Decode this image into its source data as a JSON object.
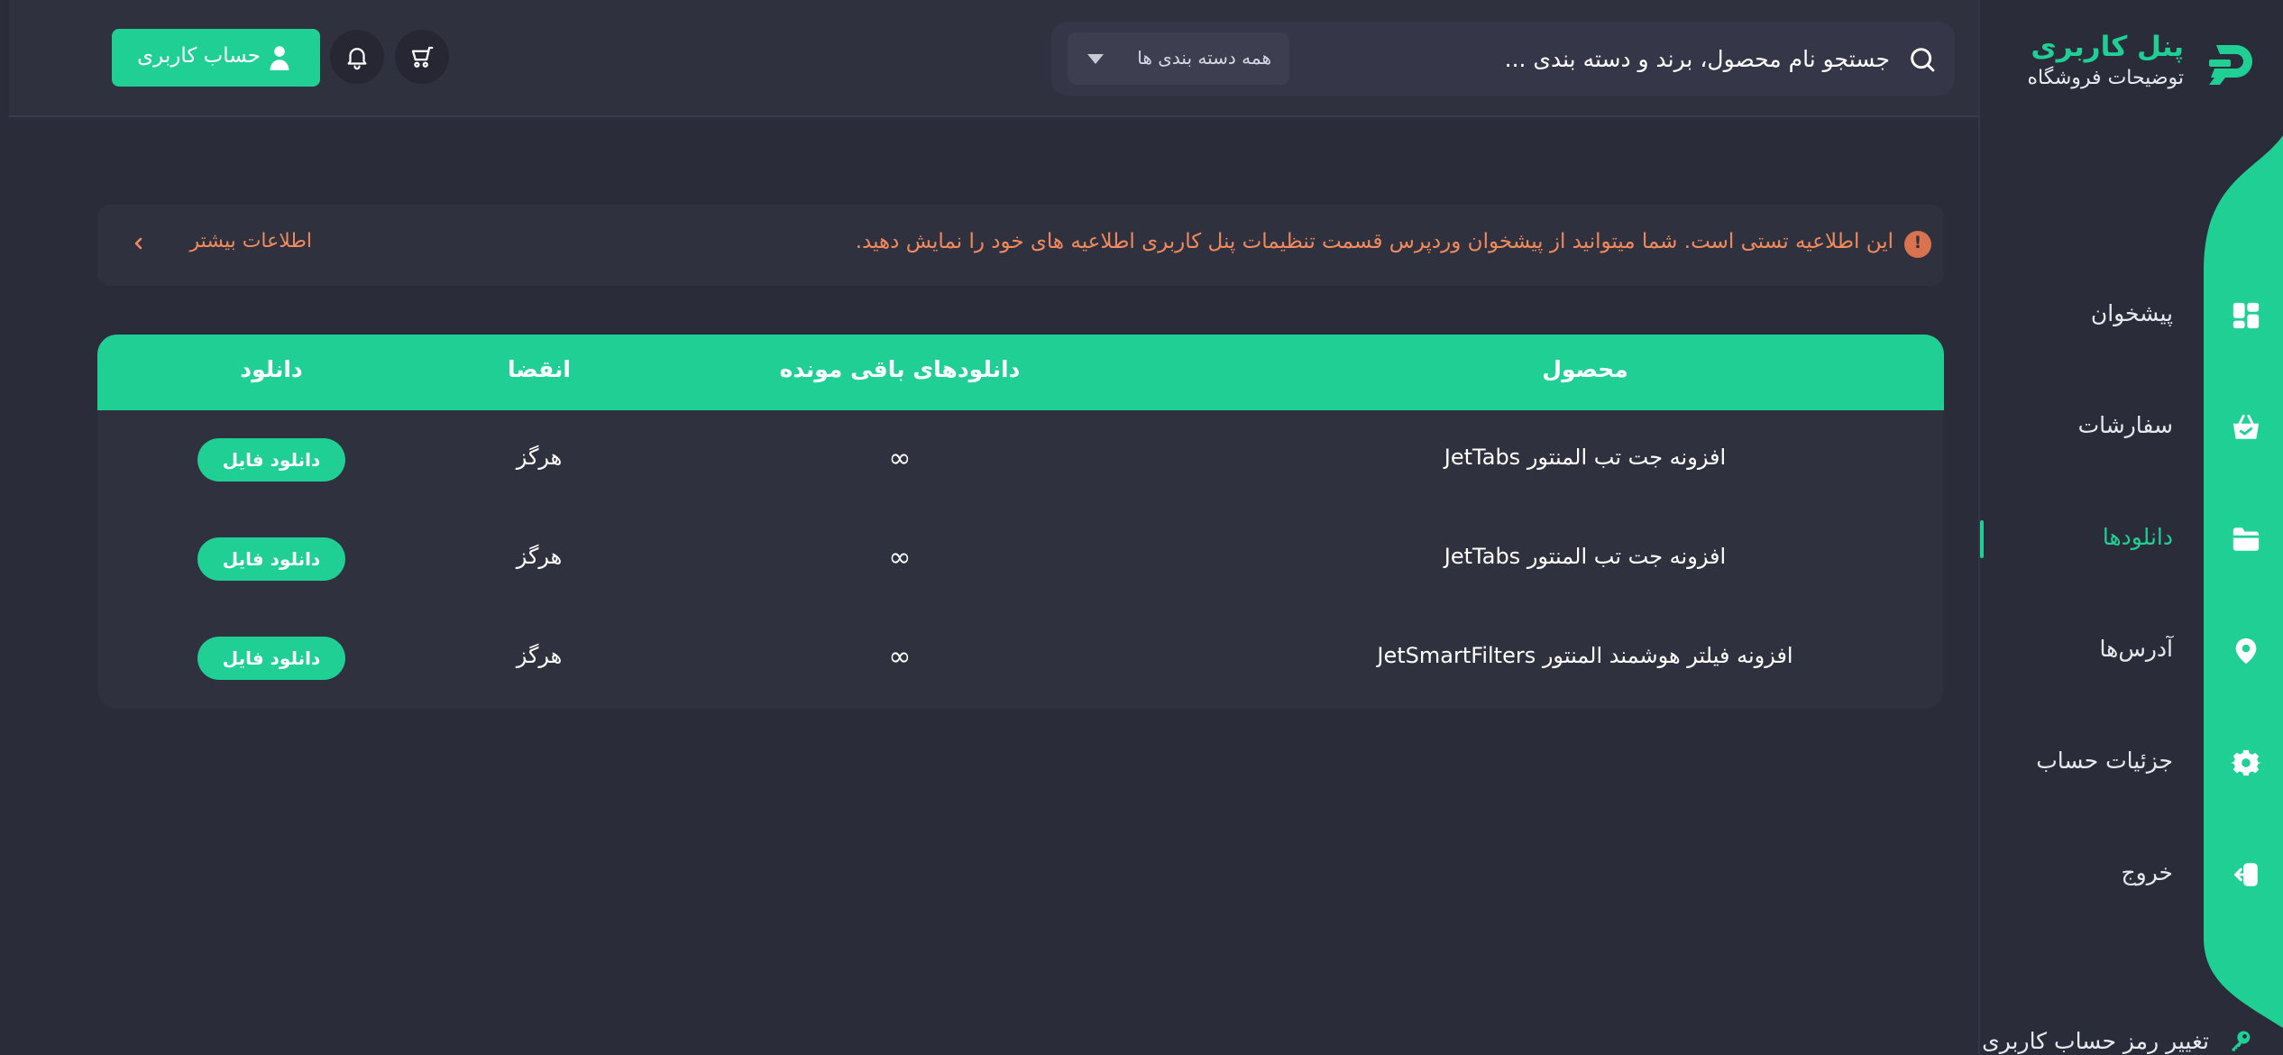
{
  "brand": {
    "title": "پنل کاربری",
    "subtitle": "توضیحات فروشگاه",
    "logo_icon": "brand-logo-icon"
  },
  "sidebar": {
    "items": [
      {
        "label": "پیشخوان",
        "icon": "dashboard-grid-icon",
        "active": false
      },
      {
        "label": "سفارشات",
        "icon": "basket-icon",
        "active": false
      },
      {
        "label": "دانلودها",
        "icon": "folder-icon",
        "active": true
      },
      {
        "label": "آدرس‌ها",
        "icon": "location-pin-icon",
        "active": false
      },
      {
        "label": "جزئیات حساب",
        "icon": "gear-icon",
        "active": false
      },
      {
        "label": "خروج",
        "icon": "logout-icon",
        "active": false
      }
    ],
    "change_password": {
      "label": "تغییر رمز حساب کاربری",
      "icon": "key-icon"
    }
  },
  "header": {
    "search": {
      "placeholder": "جستجو نام محصول، برند و دسته بندی ..."
    },
    "category_select": {
      "selected": "همه دسته بندی ها"
    },
    "account_button": {
      "label": "حساب کاربری"
    },
    "cart_icon": "cart-icon",
    "bell_icon": "bell-icon"
  },
  "notice": {
    "text": "این اطلاعیه تستی است. شما میتوانید از پیشخوان وردپرس قسمت تنظیمات پنل کاربری اطلاعیه های خود را نمایش دهید.",
    "more_label": "اطلاعات بیشتر",
    "icon_glyph": "!"
  },
  "downloads_table": {
    "headers": {
      "product": "محصول",
      "remaining": "دانلودهای باقی مونده",
      "expires": "انقضا",
      "download": "دانلود"
    },
    "rows": [
      {
        "product": "افزونه جت تب المنتور JetTabs",
        "remaining": "∞",
        "expires": "هرگز",
        "button": "دانلود فایل"
      },
      {
        "product": "افزونه جت تب المنتور JetTabs",
        "remaining": "∞",
        "expires": "هرگز",
        "button": "دانلود فایل"
      },
      {
        "product": "افزونه فیلتر هوشمند المنتور JetSmartFilters",
        "remaining": "∞",
        "expires": "هرگز",
        "button": "دانلود فایل"
      }
    ]
  },
  "colors": {
    "accent": "#1fcf94",
    "background": "#2b2c3a",
    "panel": "#30313f",
    "notice": "#f08a5d"
  }
}
